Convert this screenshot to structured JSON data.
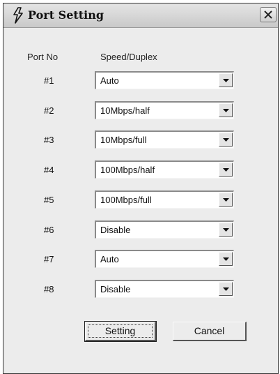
{
  "window": {
    "title": "Port Setting"
  },
  "headers": {
    "port": "Port No",
    "speed": "Speed/Duplex"
  },
  "ports": [
    {
      "label": "#1",
      "value": "Auto"
    },
    {
      "label": "#2",
      "value": "10Mbps/half"
    },
    {
      "label": "#3",
      "value": "10Mbps/full"
    },
    {
      "label": "#4",
      "value": "100Mbps/half"
    },
    {
      "label": "#5",
      "value": "100Mbps/full"
    },
    {
      "label": "#6",
      "value": "Disable"
    },
    {
      "label": "#7",
      "value": "Auto"
    },
    {
      "label": "#8",
      "value": "Disable"
    }
  ],
  "buttons": {
    "setting": "Setting",
    "cancel": "Cancel"
  },
  "icons": {
    "title": "lightning-icon",
    "close": "close-icon",
    "dropdown": "chevron-down-icon"
  }
}
